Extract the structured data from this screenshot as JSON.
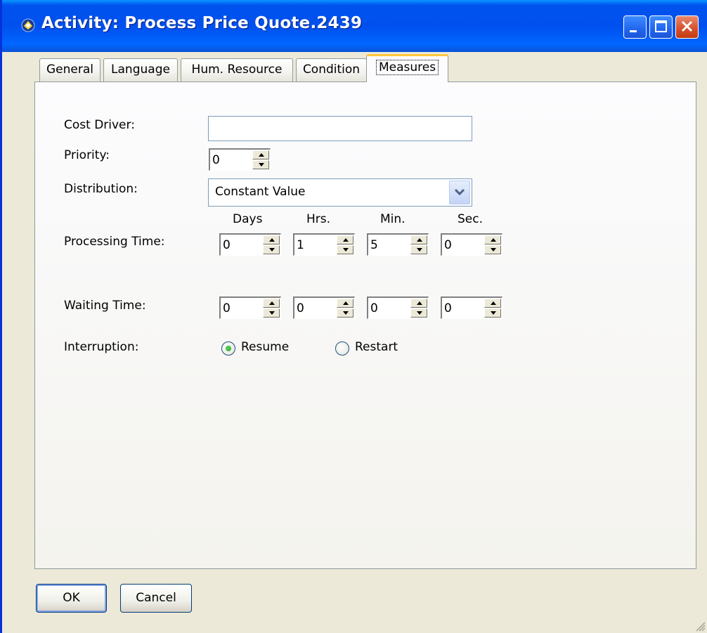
{
  "window": {
    "title": "Activity: Process Price Quote.2439",
    "icon": "app-icon",
    "controls": [
      "minimize-icon",
      "maximize-icon",
      "close-icon"
    ]
  },
  "tabs": [
    {
      "label": "General",
      "active": false
    },
    {
      "label": "Language",
      "active": false
    },
    {
      "label": "Hum. Resource",
      "active": false
    },
    {
      "label": "Condition",
      "active": false
    },
    {
      "label": "Measures",
      "active": true
    }
  ],
  "form": {
    "cost_driver": {
      "label": "Cost Driver:",
      "value": ""
    },
    "priority": {
      "label": "Priority:",
      "value": "0"
    },
    "distribution": {
      "label": "Distribution:",
      "value": "Constant Value"
    },
    "time_headers": [
      "Days",
      "Hrs.",
      "Min.",
      "Sec."
    ],
    "processing_time": {
      "label": "Processing Time:",
      "values": [
        "0",
        "1",
        "5",
        "0"
      ]
    },
    "waiting_time": {
      "label": "Waiting Time:",
      "values": [
        "0",
        "0",
        "0",
        "0"
      ]
    },
    "interruption": {
      "label": "Interruption:",
      "options": [
        {
          "label": "Resume",
          "selected": true
        },
        {
          "label": "Restart",
          "selected": false
        }
      ]
    }
  },
  "buttons": {
    "ok": "OK",
    "cancel": "Cancel"
  },
  "colors": {
    "titlebar": "#0054E3",
    "tab_highlight": "#FFC83C",
    "radio_dot": "#21A121",
    "face": "#ECE9D8"
  }
}
